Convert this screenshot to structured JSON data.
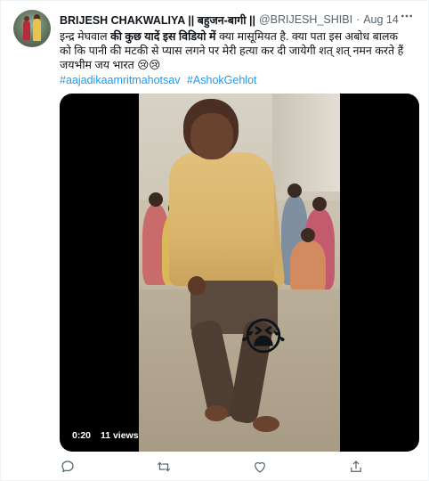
{
  "tweet": {
    "author_name": "BRIJESH CHAKWALIYA || बहुजन-बागी ||",
    "handle": "@BRIJESH_SHIBI",
    "separator": "·",
    "date": "Aug 14",
    "more_icon": "more-icon",
    "text_line1_plain": "इन्द्र मेघवाल ",
    "text_line1_bold": "की कुछ यादें इस विडियो में",
    "text_line1_rest": " क्या मासूमियत है. क्या पता इस अबोध बालक",
    "text_line2": "को कि पानी की मटकी से प्यास लगने पर मेरी हत्या कर दी जायेगी शत् शत् नमन करते हैं",
    "text_line3": "जयभीम जय भारत",
    "text_emojis": "😢😢",
    "hashtags": [
      "#aajadikaamritmahotsav",
      "#AshokGehlot"
    ]
  },
  "video": {
    "overlay_emoji": "😭",
    "duration": "0:20",
    "views": "11 views"
  },
  "actions": [
    {
      "name": "reply-icon"
    },
    {
      "name": "retweet-icon"
    },
    {
      "name": "like-icon"
    },
    {
      "name": "share-icon"
    }
  ],
  "colors": {
    "link": "#1d9bf0",
    "secondary_text": "#536471",
    "primary_text": "#0f1419"
  }
}
